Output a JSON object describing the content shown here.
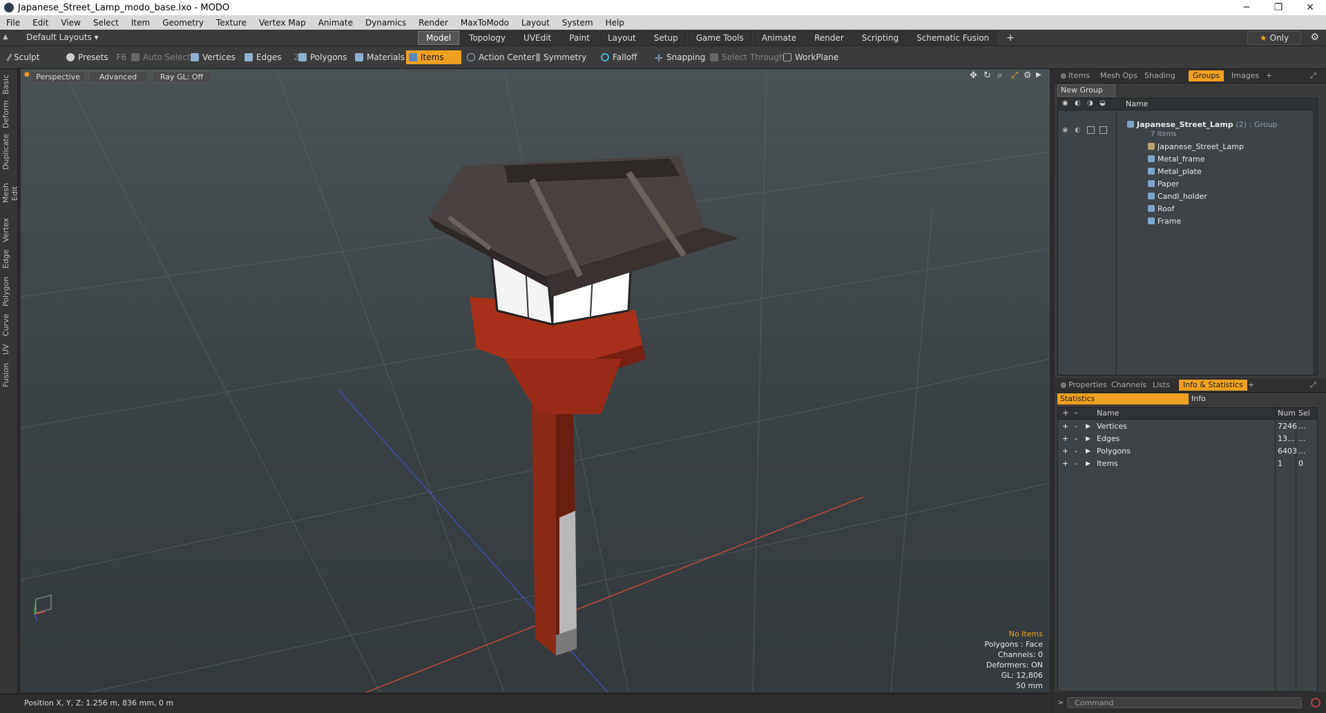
{
  "window": {
    "title": "Japanese_Street_Lamp_modo_base.lxo - MODO",
    "minimize": "─",
    "maximize": "❐",
    "close": "✕"
  },
  "menu": [
    "File",
    "Edit",
    "View",
    "Select",
    "Item",
    "Geometry",
    "Texture",
    "Vertex Map",
    "Animate",
    "Dynamics",
    "Render",
    "MaxToModo",
    "Layout",
    "System",
    "Help"
  ],
  "layout": {
    "selector": "Default Layouts ▾",
    "tabs": [
      "Model",
      "Topology",
      "UVEdit",
      "Paint",
      "Layout",
      "Setup",
      "Game Tools",
      "Animate",
      "Render",
      "Scripting",
      "Schematic Fusion"
    ],
    "active_tab": "Model",
    "add": "+",
    "only": "Only"
  },
  "toolbar": {
    "sculpt": "Sculpt",
    "presets": "Presets",
    "presets_key": "F6",
    "auto_select": "Auto Select",
    "vertices": "Vertices",
    "vertices_count": "1",
    "edges": "Edges",
    "edges_count": "2",
    "polygons": "Polygons",
    "materials": "Materials",
    "items": "Items",
    "action_center": "Action Center",
    "symmetry": "Symmetry",
    "falloff": "Falloff",
    "snapping": "Snapping",
    "select_through": "Select Through",
    "workplane": "WorkPlane"
  },
  "left_tabs": [
    "Basic",
    "Deform",
    "Duplicate",
    "Mesh Edit",
    "Vertex",
    "Edge",
    "Polygon",
    "Curve",
    "UV",
    "Fusion"
  ],
  "viewport": {
    "view": "Perspective",
    "shading": "Advanced",
    "raygl": "Ray GL: Off",
    "info": {
      "selection": "No Items",
      "polygons": "Polygons : Face",
      "channels": "Channels: 0",
      "deformers": "Deformers: ON",
      "gl": "GL: 12,806",
      "lens": "50 mm"
    }
  },
  "groups_panel": {
    "tabs": [
      "Items",
      "Mesh Ops",
      "Shading",
      "Groups",
      "Images"
    ],
    "active_tab": "Groups",
    "new_group": "New Group",
    "name_header": "Name",
    "group": {
      "name": "Japanese_Street_Lamp",
      "count": "(2)",
      "type": ": Group",
      "sub": "7 Items"
    },
    "items": [
      "Japanese_Street_Lamp",
      "Metal_frame",
      "Metal_plate",
      "Paper",
      "Candl_holder",
      "Roof",
      "Frame"
    ]
  },
  "info_panel": {
    "tabs": [
      "Properties",
      "Channels",
      "Lists",
      "Info & Statistics"
    ],
    "active_tab": "Info & Statistics",
    "subtabs": [
      "Statistics",
      "Info"
    ],
    "headers": {
      "name": "Name",
      "num": "Num",
      "sel": "Sel"
    },
    "rows": [
      {
        "name": "Vertices",
        "num": "7246",
        "sel": "..."
      },
      {
        "name": "Edges",
        "num": "13...",
        "sel": "..."
      },
      {
        "name": "Polygons",
        "num": "6403",
        "sel": "..."
      },
      {
        "name": "Items",
        "num": "1",
        "sel": "0"
      }
    ]
  },
  "status": {
    "position": "Position X, Y, Z:   1.256 m, 836 mm, 0 m"
  },
  "command": {
    "prompt": ">",
    "placeholder": "Command"
  },
  "colors": {
    "accent": "#f0a020",
    "viewport_top": "#4a5256",
    "viewport_bottom": "#343a3d"
  }
}
